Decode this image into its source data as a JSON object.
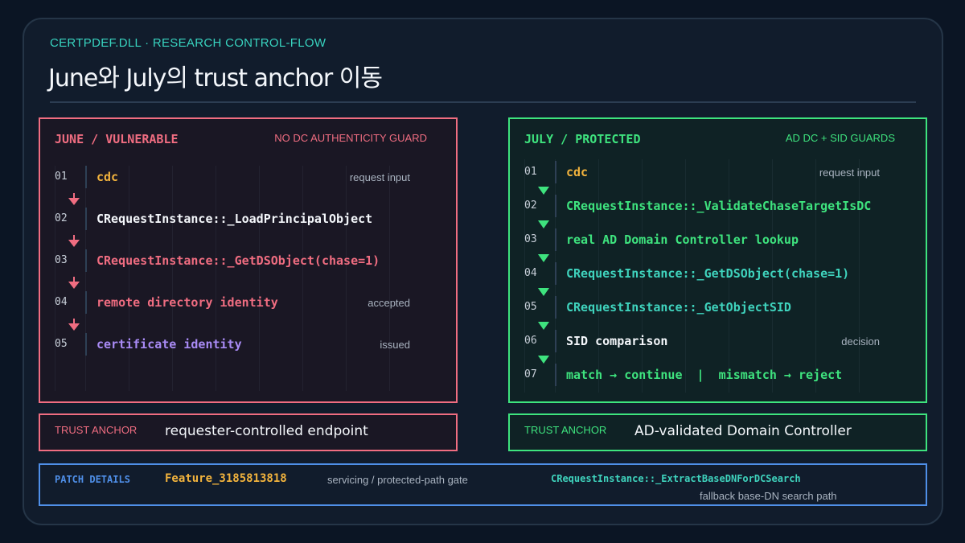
{
  "header": {
    "kicker": "CERTPDEF.DLL · RESEARCH CONTROL-FLOW",
    "title": "June와 July의 trust anchor 이동"
  },
  "june": {
    "title": "JUNE / VULNERABLE",
    "tag": "NO DC AUTHENTICITY GUARD",
    "steps": [
      {
        "num": "01",
        "code": "cdc",
        "note": "request input",
        "color": "#f2b33d"
      },
      {
        "num": "02",
        "code": "CRequestInstance::_LoadPrincipalObject",
        "note": "",
        "color": "#f4f7fb"
      },
      {
        "num": "03",
        "code": "CRequestInstance::_GetDSObject(chase=1)",
        "note": "",
        "color": "#f06d81"
      },
      {
        "num": "04",
        "code": "remote directory identity",
        "note": "accepted",
        "color": "#f06d81"
      },
      {
        "num": "05",
        "code": "certificate identity",
        "note": "issued",
        "color": "#a98bf5"
      }
    ],
    "anchor_label": "TRUST ANCHOR",
    "anchor_value": "requester-controlled endpoint"
  },
  "july": {
    "title": "JULY / PROTECTED",
    "tag": "AD DC + SID GUARDS",
    "steps": [
      {
        "num": "01",
        "code": "cdc",
        "note": "request input",
        "color": "#f2b33d"
      },
      {
        "num": "02",
        "code": "CRequestInstance::_ValidateChaseTargetIsDC",
        "note": "",
        "color": "#3ee37e"
      },
      {
        "num": "03",
        "code": "real AD Domain Controller lookup",
        "note": "",
        "color": "#3ee37e"
      },
      {
        "num": "04",
        "code": "CRequestInstance::_GetDSObject(chase=1)",
        "note": "",
        "color": "#3fd3bd"
      },
      {
        "num": "05",
        "code": "CRequestInstance::_GetObjectSID",
        "note": "",
        "color": "#3fd3bd"
      },
      {
        "num": "06",
        "code": "SID comparison",
        "note": "decision",
        "color": "#f4f7fb"
      },
      {
        "num": "07",
        "code": "match → continue  |  mismatch → reject",
        "note": "",
        "color": "#3ee37e"
      }
    ],
    "anchor_label": "TRUST ANCHOR",
    "anchor_value": "AD-validated Domain Controller"
  },
  "patch": {
    "label": "PATCH DETAILS",
    "feature": "Feature_3185813818",
    "feature_desc": "servicing / protected-path gate",
    "function": "CRequestInstance::_ExtractBaseDNForDCSearch",
    "function_desc": "fallback base-DN search path"
  },
  "colors": {
    "june_accent": "#f06d81",
    "july_accent": "#3ee37e",
    "patch_accent": "#4f8fe8",
    "kicker": "#38d3bf"
  }
}
